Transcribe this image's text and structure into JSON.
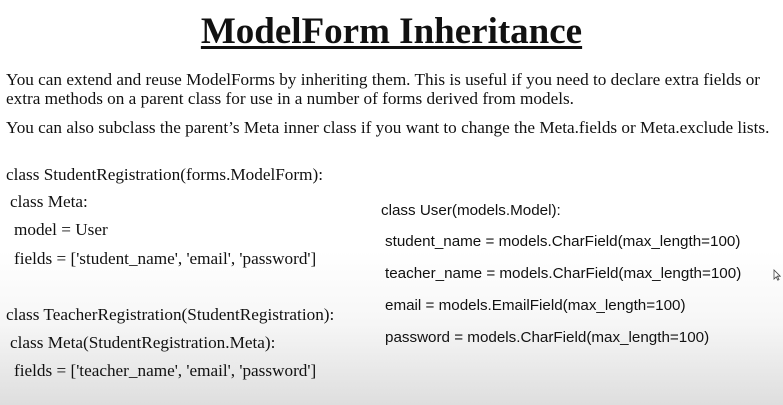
{
  "slide": {
    "title": "ModelForm Inheritance",
    "paragraphs": [
      "You can extend and reuse ModelForms by inheriting them. This is useful if you need to declare extra fields or extra methods on a parent class for use in a number of forms derived from models.",
      "You can also subclass the parent’s Meta inner class if you want to change the Meta.fields or Meta.exclude lists."
    ],
    "left_code": [
      "class StudentRegistration(forms.ModelForm):",
      "class Meta:",
      "model = User",
      "fields = ['student_name', 'email', 'password']",
      "class TeacherRegistration(StudentRegistration):",
      "class Meta(StudentRegistration.Meta):",
      "fields = ['teacher_name', 'email', 'password']"
    ],
    "right_code": [
      "class User(models.Model):",
      "student_name = models.CharField(max_length=100)",
      "teacher_name = models.CharField(max_length=100)",
      "email = models.EmailField(max_length=100)",
      "password = models.CharField(max_length=100)"
    ]
  },
  "icons": {
    "cursor": "mouse-pointer-icon"
  },
  "colors": {
    "text": "#111111",
    "background": "#ffffff"
  }
}
